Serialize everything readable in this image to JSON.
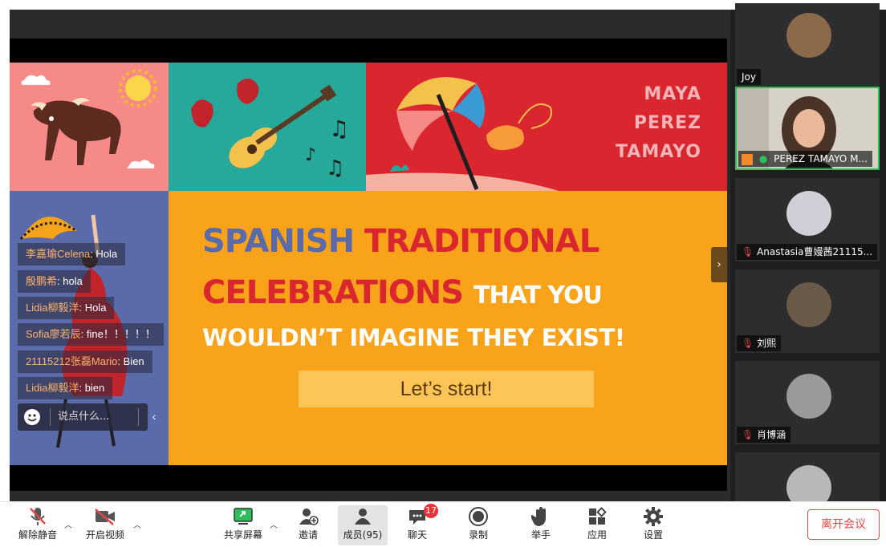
{
  "slide": {
    "author_lines": [
      "MAYA",
      "PEREZ",
      "TAMAYO"
    ],
    "title_word1": "SPANISH",
    "title_word2": "TRADITIONAL",
    "title_word3": "CELEBRATIONS",
    "title_word4": "THAT YOU",
    "title_line3": "WOULDN’T IMAGINE THEY EXIST!",
    "start_button": "Let’s start!"
  },
  "chat": {
    "messages": [
      {
        "name": "李嘉瑜Celena",
        "text": ": Hola"
      },
      {
        "name": "殷鹏希",
        "text": ": hola"
      },
      {
        "name": "Lidia柳毅洋",
        "text": ": Hola"
      },
      {
        "name": "Sofia廖若辰",
        "text": ": fine！！！！！"
      },
      {
        "name": "21115212张磊Mario",
        "text": ": Bien"
      },
      {
        "name": "Lidia柳毅洋",
        "text": ": bien"
      }
    ],
    "input_placeholder": "说点什么..."
  },
  "participants": [
    {
      "name": "Joy",
      "avatar_color": "#8a6a4a"
    },
    {
      "name": "PEREZ TAMAYO M...",
      "avatar_color": "#5a4838",
      "active": true
    },
    {
      "name": "Anastasia曹嫚茜21115...",
      "avatar_color": "#cfcfd8"
    },
    {
      "name": "刘熙",
      "avatar_color": "#6a5a4a"
    },
    {
      "name": "肖博涵",
      "avatar_color": "#9a9a9a"
    },
    {
      "name": "",
      "avatar_color": "#b8b8b8"
    }
  ],
  "toolbar": {
    "unmute": "解除静音",
    "start_video": "开启视频",
    "share_screen": "共享屏幕",
    "invite": "邀请",
    "members": "成员(95)",
    "chat": "聊天",
    "chat_badge": "17",
    "record": "录制",
    "raise_hand": "举手",
    "apps": "应用",
    "settings": "设置",
    "leave": "离开会议"
  },
  "colors": {
    "accent_green": "#2dbf5a",
    "leave_red": "#e24a4a",
    "badge_red": "#e8323a"
  }
}
